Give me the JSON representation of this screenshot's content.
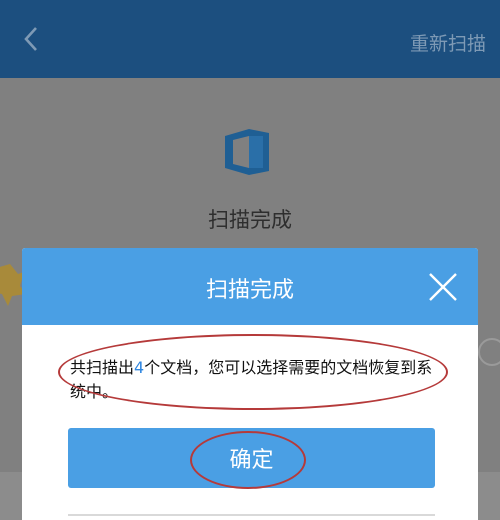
{
  "topbar": {
    "back_icon": "chevron-left-icon",
    "rescan_label": "重新扫描"
  },
  "background": {
    "app_icon": "office-icon",
    "title": "扫描完成"
  },
  "dialog": {
    "title": "扫描完成",
    "close_icon": "close-icon",
    "message_prefix": "共扫描出",
    "message_count": "4",
    "message_suffix": "个文档，您可以选择需要的文档恢复到系统中。",
    "ok_label": "确定"
  },
  "colors": {
    "dialog_header": "#4a9fe4",
    "ok_button": "#4a9fe4",
    "annotation": "#b53a3a",
    "count_highlight": "#2f86e0"
  }
}
